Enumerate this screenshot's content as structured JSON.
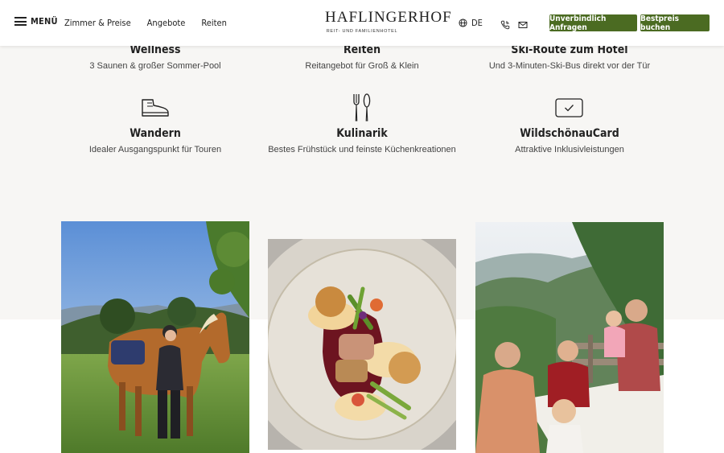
{
  "header": {
    "menu_label": "MENÜ",
    "nav": [
      "Zimmer & Preise",
      "Angebote",
      "Reiten"
    ],
    "logo_main": "HAFLINGERHOF",
    "logo_sub": "REIT- UND FAMILIENHOTEL",
    "language": "DE",
    "inquiry_button": "Unverbindlich Anfragen",
    "book_button": "Bestpreis buchen"
  },
  "features": [
    {
      "title": "Wellness",
      "desc": "3 Saunen & großer Sommer-Pool"
    },
    {
      "title": "Reiten",
      "desc": "Reitangebot für Groß & Klein"
    },
    {
      "title": "Ski-Route zum Hotel",
      "desc": "Und 3-Minuten-Ski-Bus direkt vor der Tür"
    },
    {
      "title": "Wandern",
      "desc": "Idealer Ausgangspunkt für Touren"
    },
    {
      "title": "Kulinarik",
      "desc": "Bestes Frühstück und feinste Küchenkreationen"
    },
    {
      "title": "WildschönauCard",
      "desc": "Attraktive Inklusivleistungen"
    }
  ],
  "colors": {
    "accent_green": "#4b6b22",
    "band": "#f7f6f4"
  },
  "icons": [
    "hiking-boot-icon",
    "cutlery-icon",
    "card-check-icon",
    "globe-icon",
    "phone-icon",
    "mail-icon",
    "hamburger-icon"
  ]
}
